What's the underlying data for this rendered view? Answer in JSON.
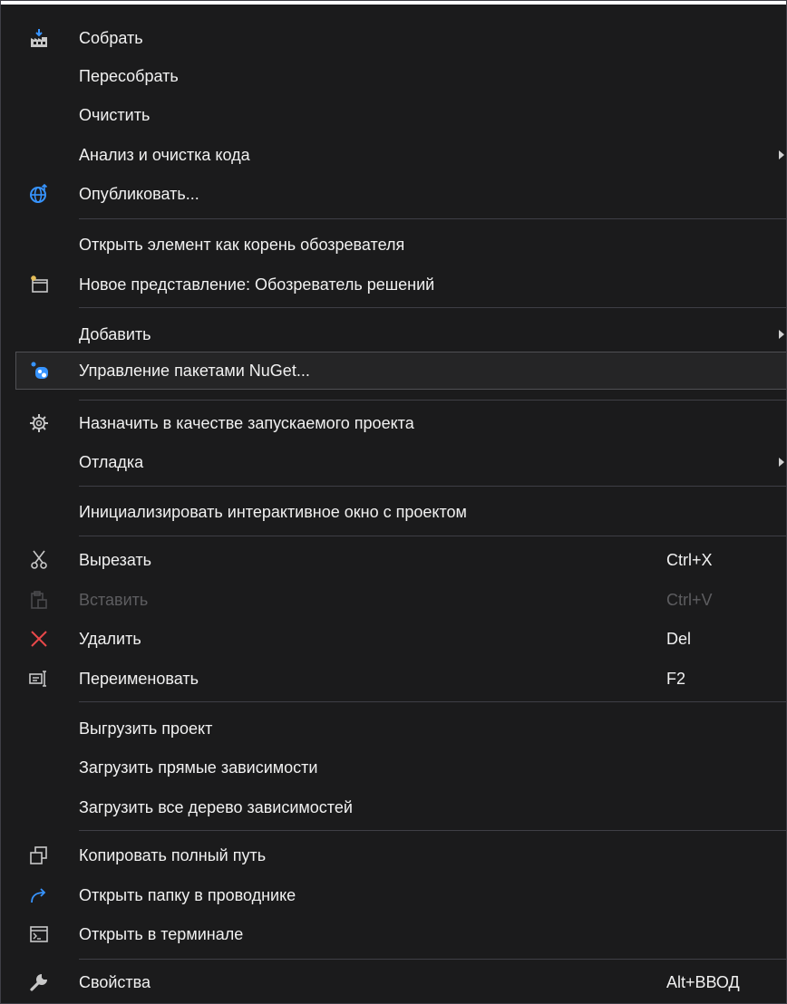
{
  "menu": {
    "items": [
      {
        "label": "Собрать",
        "icon": "build-icon"
      },
      {
        "label": "Пересобрать"
      },
      {
        "label": "Очистить"
      },
      {
        "label": "Анализ и очистка кода",
        "submenu": true
      },
      {
        "label": "Опубликовать...",
        "icon": "publish-globe-icon"
      },
      {
        "label": "Открыть элемент как корень обозревателя"
      },
      {
        "label": "Новое представление: Обозреватель решений",
        "icon": "new-view-icon"
      },
      {
        "label": "Добавить",
        "submenu": true
      },
      {
        "label": "Управление пакетами NuGet...",
        "icon": "nuget-icon",
        "highlighted": true
      },
      {
        "label": "Назначить в качестве запускаемого проекта",
        "icon": "settings-gear-icon"
      },
      {
        "label": "Отладка",
        "submenu": true
      },
      {
        "label": "Инициализировать интерактивное окно с проектом"
      },
      {
        "label": "Вырезать",
        "shortcut": "Ctrl+X",
        "icon": "scissors-icon"
      },
      {
        "label": "Вставить",
        "shortcut": "Ctrl+V",
        "icon": "paste-icon",
        "disabled": true
      },
      {
        "label": "Удалить",
        "shortcut": "Del",
        "icon": "delete-x-icon"
      },
      {
        "label": "Переименовать",
        "shortcut": "F2",
        "icon": "rename-icon"
      },
      {
        "label": "Выгрузить проект"
      },
      {
        "label": "Загрузить прямые зависимости"
      },
      {
        "label": "Загрузить все дерево зависимостей"
      },
      {
        "label": "Копировать полный путь",
        "icon": "copy-icon"
      },
      {
        "label": "Открыть папку в проводнике",
        "icon": "open-folder-arrow-icon"
      },
      {
        "label": "Открыть в терминале",
        "icon": "terminal-icon"
      },
      {
        "label": "Свойства",
        "shortcut": "Alt+ВВОД",
        "icon": "wrench-icon"
      }
    ]
  }
}
